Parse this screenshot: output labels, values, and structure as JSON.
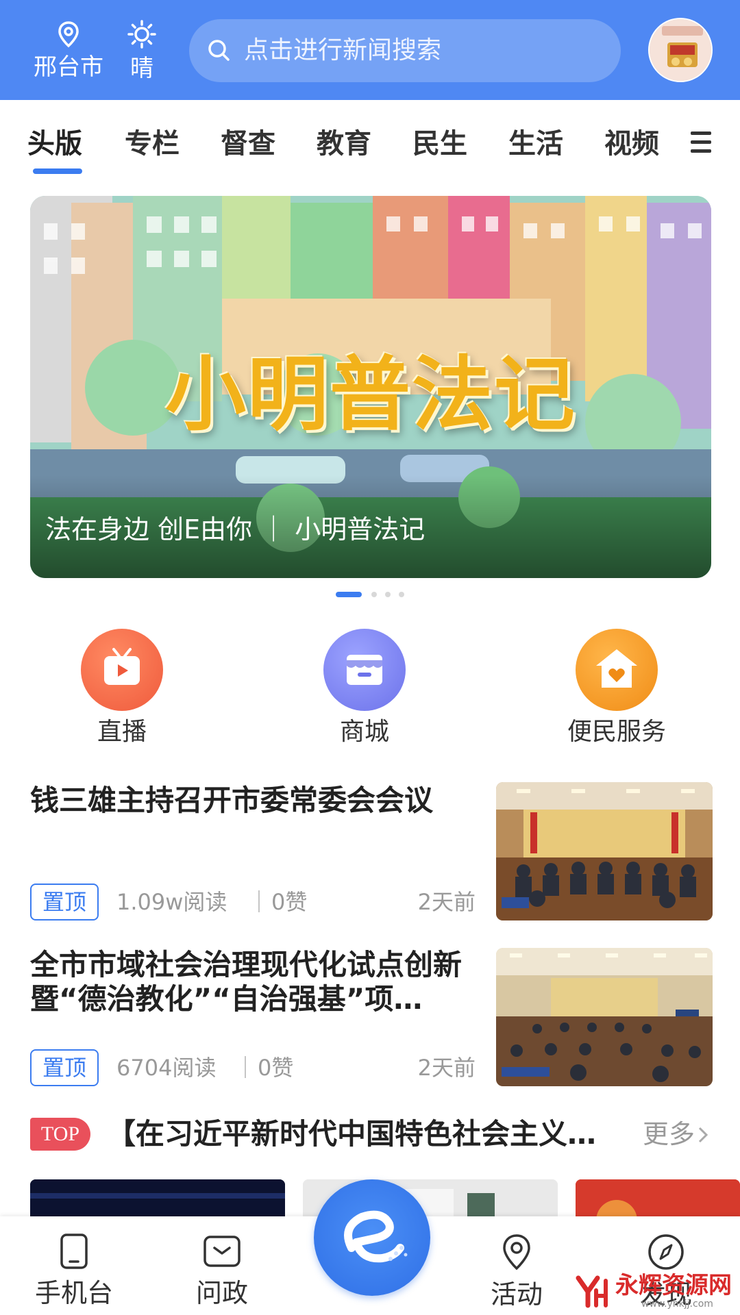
{
  "header": {
    "city": "邢台市",
    "weather": "晴",
    "search_placeholder": "点击进行新闻搜索",
    "location_icon": "location-pin-icon",
    "weather_icon": "sun-icon",
    "brand_color": "#4f88f3"
  },
  "tabs": [
    "头版",
    "专栏",
    "督查",
    "教育",
    "民生",
    "生活",
    "视频"
  ],
  "active_tab": "头版",
  "banner": {
    "title": "小明普法记",
    "caption": "法在身边 创E由你 ｜ 小明普法记",
    "page_count": 4,
    "active_page": 1
  },
  "quick": [
    {
      "label": "直播",
      "icon": "tv-play-icon",
      "color": "#f2694a"
    },
    {
      "label": "商城",
      "icon": "shop-icon",
      "color": "#7e86f2"
    },
    {
      "label": "便民服务",
      "icon": "house-heart-icon",
      "color": "#f29a1f"
    }
  ],
  "news": [
    {
      "title": "钱三雄主持召开市委常委会会议",
      "tag": "置顶",
      "reads": "1.09w阅读",
      "separator": "｜",
      "likes": "0赞",
      "time": "2天前"
    },
    {
      "title": "全市市域社会治理现代化试点创新暨“德治教化”“自治强基”项…",
      "tag": "置顶",
      "reads": "6704阅读",
      "separator": "｜",
      "likes": "0赞",
      "time": "2天前"
    }
  ],
  "ticker": {
    "badge": "TOP",
    "text": "【在习近平新时代中国特色社会主义…",
    "more": "更多"
  },
  "bottom_nav": [
    {
      "label": "手机台",
      "icon": "phone-icon"
    },
    {
      "label": "问政",
      "icon": "message-icon"
    },
    {
      "label": "活动",
      "icon": "location-pin-icon"
    },
    {
      "label": "发现",
      "icon": "compass-icon"
    }
  ],
  "watermark": {
    "text": "永辉资源网",
    "url": "www.yhkjj.com"
  }
}
